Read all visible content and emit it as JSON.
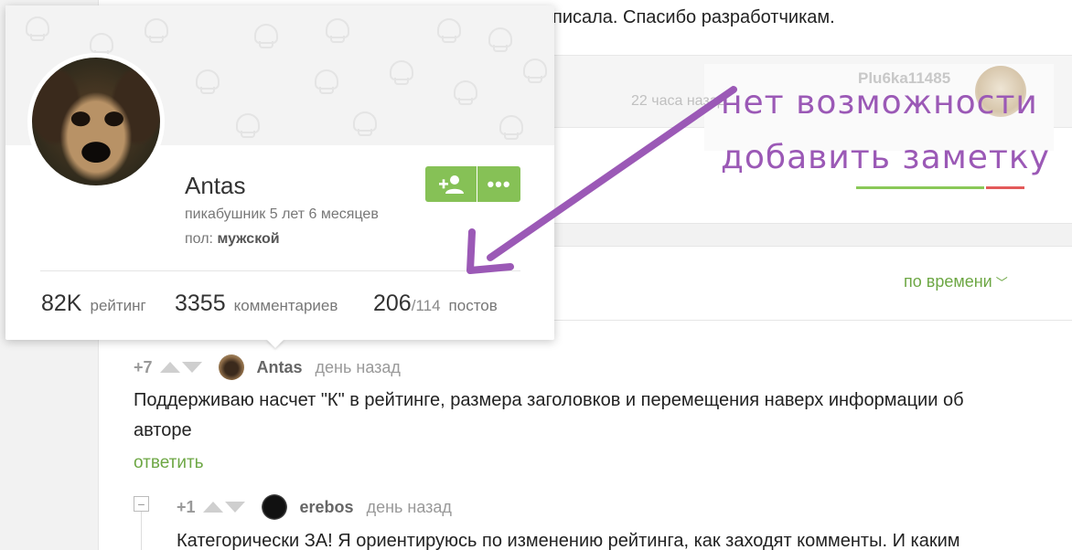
{
  "colors": {
    "accent_green": "#86c156",
    "link_green": "#6da744",
    "annotation_purple": "#9b59b6",
    "rating_red": "#e35a5a"
  },
  "story": {
    "text_fragment": "писала. Спасибо разработчикам.",
    "author": "Plu6ka11485",
    "time": "22 часа назад"
  },
  "annotation": {
    "line1": "нет возможности",
    "line2": "добавить заметку"
  },
  "sort": {
    "label": "по времени",
    "icon": "chevron-down-icon"
  },
  "profile_card": {
    "name": "Antas",
    "tenure": "пикабушник 5 лет 6 месяцев",
    "gender_label": "пол:",
    "gender_value": "мужской",
    "follow_icon": "add-user-icon",
    "more_label": "•••",
    "stats": {
      "rating_value": "82K",
      "rating_label": "рейтинг",
      "comments_value": "3355",
      "comments_label": "комментариев",
      "posts_value": "206",
      "posts_sub": "/114",
      "posts_label": "постов"
    }
  },
  "comments": [
    {
      "score": "+7",
      "author": "Antas",
      "time": "день назад",
      "text_line1": "Поддерживаю насчет \"К\" в рейтинге, размера заголовков и перемещения наверх информации об",
      "text_line2": "авторе",
      "reply_label": "ответить"
    },
    {
      "score": "+1",
      "author": "erebos",
      "time": "день назад",
      "collapse_label": "−",
      "text_line1": "Категорически ЗА! Я ориентируюсь по изменению рейтинга, как заходят комменты. И каким"
    }
  ]
}
